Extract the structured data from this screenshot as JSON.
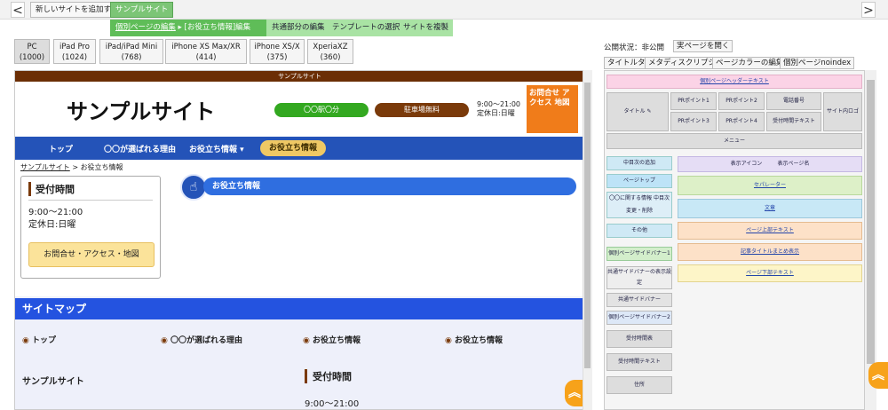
{
  "topbar": {
    "back": "<",
    "forward": ">",
    "add_site": "新しいサイトを追加する",
    "site_name": "サンプルサイト"
  },
  "subnav": {
    "items": [
      "個別ページの編集",
      "[お役立ち情報]編集",
      "共通部分の編集",
      "テンプレートの選択",
      "サイトを複製"
    ]
  },
  "devices": [
    {
      "name": "PC",
      "size": "(1000)"
    },
    {
      "name": "iPad Pro",
      "size": "(1024)"
    },
    {
      "name": "iPad/iPad Mini",
      "size": "(768)"
    },
    {
      "name": "iPhone XS Max/XR",
      "size": "(414)"
    },
    {
      "name": "iPhone XS/X",
      "size": "(375)"
    },
    {
      "name": "XperiaXZ",
      "size": "(360)"
    }
  ],
  "site": {
    "topline": "サンプルサイト",
    "logo": "サンプルサイト",
    "badge_station": "〇〇駅〇分",
    "badge_parking": "駐車場無料",
    "hours": "9:00～21:00",
    "closed": "定休日:日曜",
    "contact_btn": "お問合せ アクセス 地図",
    "nav": [
      "トップ",
      "〇〇が選ばれる理由",
      "お役立ち情報",
      "お役立ち情報"
    ],
    "nav_chevron": "▾",
    "breadcrumb_home": "サンプルサイト",
    "breadcrumb_sep": ">",
    "breadcrumb_current": "お役立ち情報",
    "side_title": "受付時間",
    "side_hours": "9:00～21:00",
    "side_closed": "定休日:日曜",
    "side_btn": "お問合せ・アクセス・地図",
    "content_title": "お役立ち情報",
    "sitemap_title": "サイトマップ",
    "sitemap_links": [
      "トップ",
      "〇〇が選ばれる理由",
      "お役立ち情報",
      "お役立ち情報"
    ],
    "footer_name": "サンプルサイト",
    "footer_hours_title": "受付時間",
    "footer_hours": "9:00～21:00"
  },
  "right": {
    "status": "公開状況：非公開",
    "view_page": "実ページを開く",
    "tabs": [
      "タイトルタグ",
      "メタディスクリプション",
      "ページカラーの編集",
      "個別ページnoindex"
    ],
    "header_text": "個別ページヘッダーテキスト",
    "title": "タイトル",
    "pr": [
      "PRポイント1",
      "PRポイント2",
      "PRポイント3",
      "PRポイント4"
    ],
    "phone": "電話番号",
    "hours_text": "受付時間テキスト",
    "site_logo": "サイト内ロゴ",
    "menu": "メニュー",
    "middle_add": "中目次の追加",
    "page_top": "ページトップ",
    "change_mid": "〇〇に関する情報 中目次変更・削除",
    "other": "その他",
    "display_icon": "表示アイコン",
    "display_page": "表示ページ名",
    "separator": "セパレーター",
    "text": "文章",
    "page_top_text": "ページ上部テキスト",
    "article_title": "記事タイトルまとめ表示",
    "page_bottom_text": "ページ下部テキスト",
    "side_banner1": "個別ページサイドバナー1",
    "common_side_display": "共通サイドバナーの表示設定",
    "common_side_banner": "共通サイドバナー",
    "side_banner2": "個別ページサイドバナー2",
    "reception_time": "受付時間表",
    "reception_text": "受付時間テキスト",
    "address": "住所",
    "edit_icon": "✎"
  },
  "colors": {
    "accent_green": "#7cc576",
    "nav_blue": "#2453b8",
    "orange": "#f07c1a",
    "brown": "#7a3a0a"
  }
}
